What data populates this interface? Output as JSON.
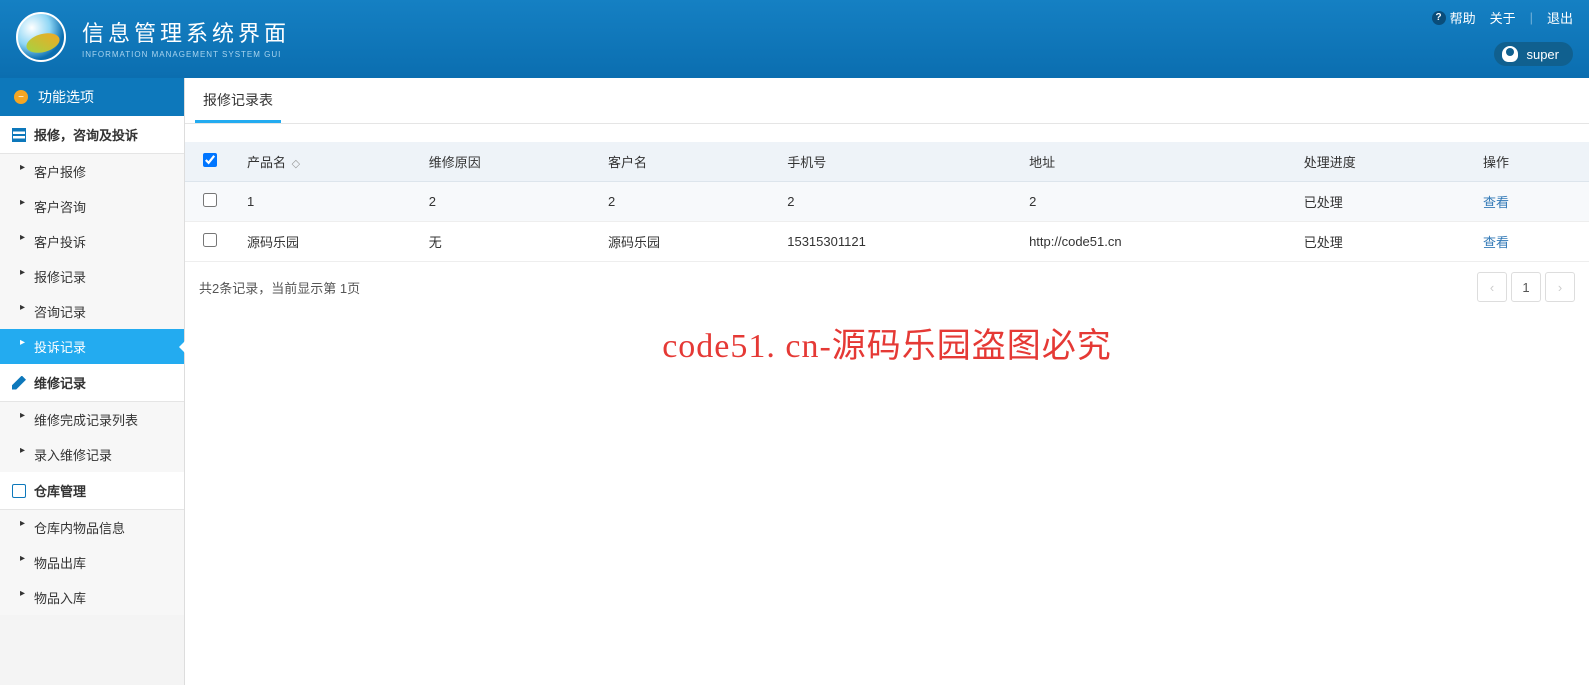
{
  "header": {
    "title": "信息管理系统界面",
    "subtitle": "INFORMATION MANAGEMENT SYSTEM GUI",
    "help": "帮助",
    "about": "关于",
    "logout": "退出",
    "user": "super"
  },
  "sidebar": {
    "main_header": "功能选项",
    "groups": [
      {
        "label": "报修，咨询及投诉",
        "icon": "list",
        "items": [
          {
            "label": "客户报修",
            "active": false
          },
          {
            "label": "客户咨询",
            "active": false
          },
          {
            "label": "客户投诉",
            "active": false
          },
          {
            "label": "报修记录",
            "active": false
          },
          {
            "label": "咨询记录",
            "active": false
          },
          {
            "label": "投诉记录",
            "active": true
          }
        ]
      },
      {
        "label": "维修记录",
        "icon": "edit",
        "items": [
          {
            "label": "维修完成记录列表",
            "active": false
          },
          {
            "label": "录入维修记录",
            "active": false
          }
        ]
      },
      {
        "label": "仓库管理",
        "icon": "chat",
        "items": [
          {
            "label": "仓库内物品信息",
            "active": false
          },
          {
            "label": "物品出库",
            "active": false
          },
          {
            "label": "物品入库",
            "active": false
          }
        ]
      }
    ]
  },
  "tab": {
    "label": "报修记录表"
  },
  "table": {
    "columns": [
      "产品名",
      "维修原因",
      "客户名",
      "手机号",
      "地址",
      "处理进度",
      "操作"
    ],
    "sort_indicator": "◇",
    "rows": [
      {
        "product": "1",
        "reason": "2",
        "customer": "2",
        "phone": "2",
        "address": "2",
        "status": "已处理",
        "action": "查看"
      },
      {
        "product": "源码乐园",
        "reason": "无",
        "customer": "源码乐园",
        "phone": "15315301121",
        "address": "http://code51.cn",
        "status": "已处理",
        "action": "查看"
      }
    ],
    "summary": "共2条记录，当前显示第 1页"
  },
  "pagination": {
    "prev": "‹",
    "page": "1",
    "next": "›"
  },
  "watermark": "code51. cn-源码乐园盗图必究"
}
